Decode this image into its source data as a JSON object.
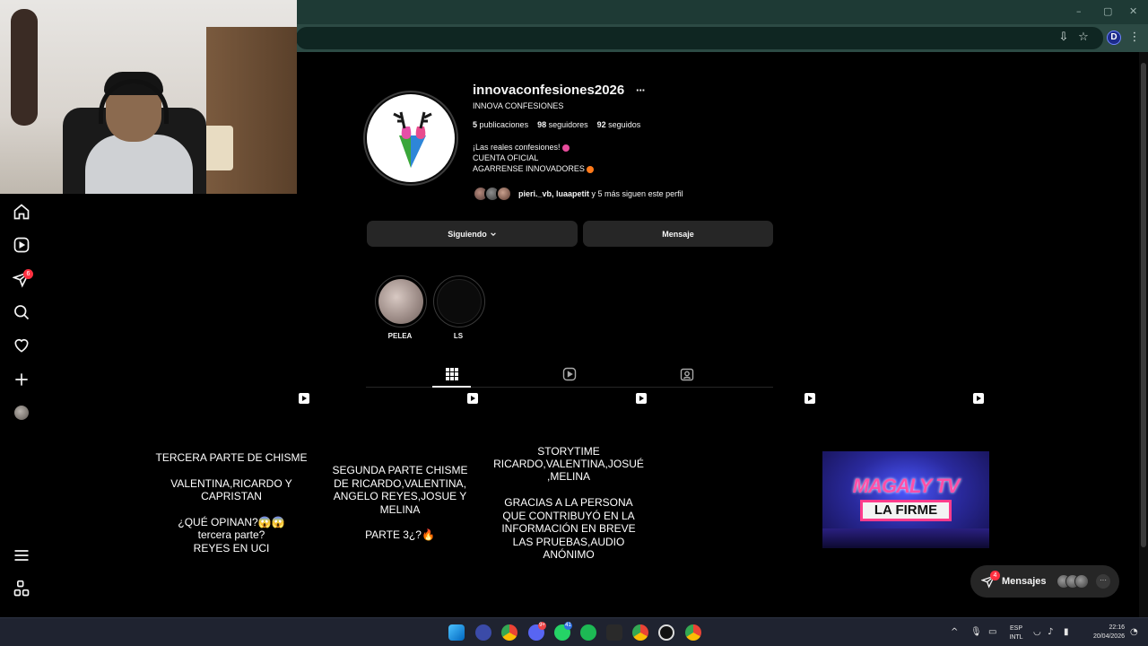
{
  "browser": {
    "window_controls": [
      "–",
      "▢",
      "✕"
    ],
    "profile_initial": "D"
  },
  "nav": {
    "icons": [
      "home-icon",
      "reels-icon",
      "messages-icon",
      "search-icon",
      "notifications-icon",
      "create-icon",
      "profile-avatar",
      "more-menu-icon",
      "meta-apps-icon"
    ],
    "messages_badge": "6"
  },
  "profile": {
    "username": "innovaconfesiones2026",
    "more": "···",
    "full_name": "INNOVA CONFESIONES",
    "stats": {
      "posts_count": "5",
      "posts_label": "publicaciones",
      "followers_count": "98",
      "followers_label": "seguidores",
      "following_count": "92",
      "following_label": "seguidos"
    },
    "bio_lines": [
      "¡Las reales confesiones!",
      "CUENTA OFICIAL",
      "AGARRENSE INNOVADORES"
    ],
    "followed_by": {
      "names": "pieri._vb, luaapetit",
      "rest": " y 5 más siguen este perfil"
    }
  },
  "actions": {
    "following_label": "Siguiendo",
    "message_label": "Mensaje"
  },
  "highlights": [
    {
      "label": "PELEA"
    },
    {
      "label": "LS"
    }
  ],
  "posts": [
    {
      "caption": "TERCERA PARTE DE CHISME\n\nVALENTINA,RICARDO Y CAPRISTAN\n\n¿QUÉ OPINAN?😱😱\ntercera parte?\nREYES EN UCI"
    },
    {
      "caption": "SEGUNDA PARTE CHISME DE RICARDO,VALENTINA, ANGELO REYES,JOSUE Y MELINA\n\nPARTE 3¿?🔥"
    },
    {
      "caption": "STORYTIME\nRICARDO,VALENTINA,JOSUÉ ,MELINA\n\nGRACIAS A LA PERSONA QUE CONTRIBUYÓ EN LA INFORMACIÓN EN BREVE LAS PRUEBAS,AUDIO ANÓNIMO"
    },
    {
      "caption": ""
    },
    {
      "caption": "",
      "thumb_title": "MAGALY TV",
      "thumb_sub": "LA FIRME"
    }
  ],
  "messages_pill": {
    "label": "Mensajes",
    "badge": "4",
    "more": "···"
  },
  "taskbar": {
    "lang_top": "ESP",
    "lang_bottom": "INTL",
    "time": "22:16",
    "date": "20/04/2026",
    "badges": {
      "discord": "9+",
      "whatsapp": "41"
    }
  },
  "colors": {
    "accent_badge": "#ff3040",
    "button_bg": "#262626",
    "browser_frame": "#1e3a35"
  }
}
